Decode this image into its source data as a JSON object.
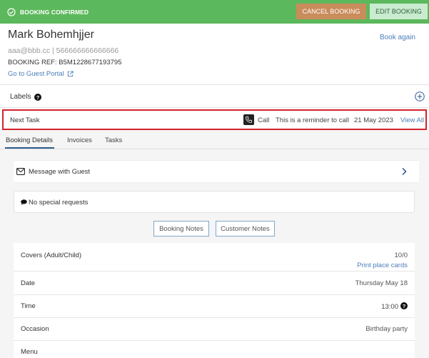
{
  "header": {
    "status": "BOOKING CONFIRMED",
    "cancel_label": "CANCEL BOOKING",
    "edit_label": "EDIT BOOKING"
  },
  "guest": {
    "name": "Mark Bohemhjjer",
    "book_again": "Book again",
    "contact": "aaa@bbb.cc | 566666666666666",
    "booking_ref": "BOOKING REF: B5M1228677193795",
    "portal_link": "Go to Guest Portal"
  },
  "labels": {
    "title": "Labels"
  },
  "next_task": {
    "label": "Next Task",
    "type": "Call",
    "message": "This is a reminder to call",
    "date": "21 May 2023",
    "view_all": "View All"
  },
  "tabs": [
    {
      "label": "Booking Details",
      "active": true
    },
    {
      "label": "Invoices",
      "active": false
    },
    {
      "label": "Tasks",
      "active": false
    }
  ],
  "message": {
    "label": "Message with Guest"
  },
  "special_requests": {
    "text": "No special requests"
  },
  "notes": {
    "booking_notes": "Booking Notes",
    "customer_notes": "Customer Notes"
  },
  "details": {
    "covers_label": "Covers (Adult/Child)",
    "covers_value": "10/0",
    "print_cards": "Print place cards",
    "date_label": "Date",
    "date_value": "Thursday May 18",
    "time_label": "Time",
    "time_value": "13:00",
    "occasion_label": "Occasion",
    "occasion_value": "Birthday party",
    "menu_label": "Menu"
  },
  "colors": {
    "topbar": "#5cb85c",
    "cancel": "#c98c5b",
    "edit": "#c9ecd0",
    "link": "#4a7eb8",
    "highlight_border": "#d3232c",
    "tab_active": "#2d5d8d"
  }
}
